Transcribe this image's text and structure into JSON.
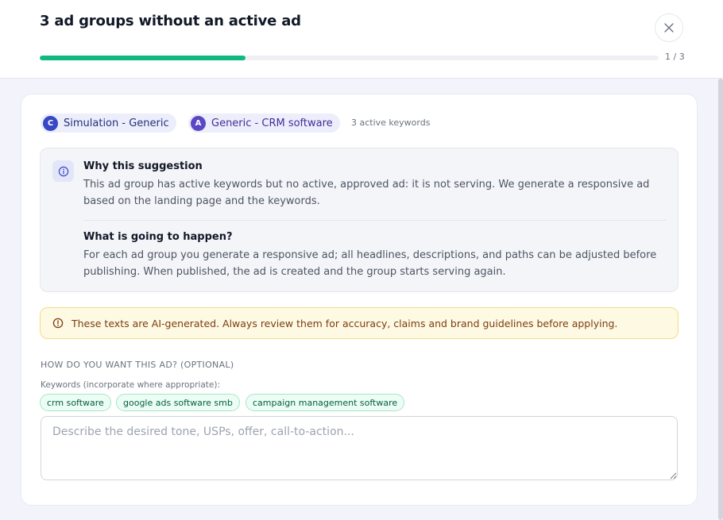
{
  "dialog": {
    "title": "3 ad groups without an active ad",
    "progress": {
      "current": 1,
      "total": 3,
      "label": "1 / 3",
      "fraction": 0.333
    },
    "close_icon": "close-icon"
  },
  "breadcrumb": {
    "campaign": {
      "badge": "C",
      "name": "Simulation - Generic"
    },
    "ad_group": {
      "badge": "A",
      "name": "Generic - CRM software"
    },
    "keyword_count": "3 active keywords"
  },
  "info": {
    "icon": "info-icon",
    "why_title": "Why this suggestion",
    "why_text": "This ad group has active keywords but no active, approved ad: it is not serving. We generate a responsive ad based on the landing page and the keywords.",
    "what_title": "What is going to happen?",
    "what_text": "For each ad group you generate a responsive ad; all headlines, descriptions, and paths can be adjusted before publishing. When published, the ad is created and the group starts serving again."
  },
  "warning": {
    "icon": "warning-icon",
    "text": "These texts are AI-generated. Always review them for accuracy, claims and brand guidelines before applying."
  },
  "form": {
    "section_label": "HOW DO YOU WANT THIS AD? (OPTIONAL)",
    "keywords_label": "Keywords (incorporate where appropriate):",
    "keywords": [
      "crm software",
      "google ads software smb",
      "campaign management software"
    ],
    "textarea_placeholder": "Describe the desired tone, USPs, offer, call-to-action...",
    "textarea_value": ""
  },
  "colors": {
    "accent": "#10b981",
    "chip_bg": "#eceefb",
    "warning_bg": "#fef9e3"
  }
}
